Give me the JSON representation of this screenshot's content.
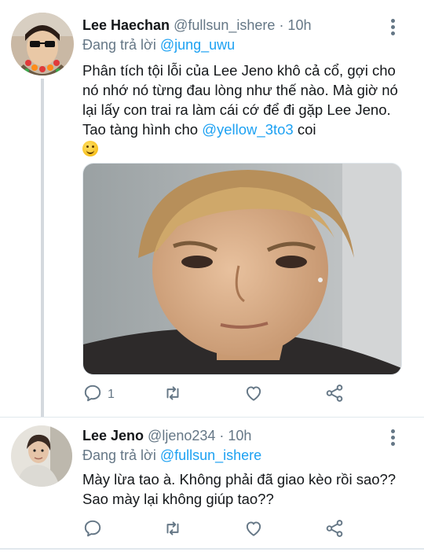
{
  "tweets": [
    {
      "name": "Lee Haechan",
      "handle": "@fullsun_ishere",
      "time": "· 10h",
      "reply_prefix": "Đang trả lời ",
      "reply_to": "@jung_uwu",
      "text_part1": "Phân tích tội lỗi của Lee Jeno khô cả cổ, gợi cho nó nhớ nó từng đau lòng như thế nào. Mà giờ nó lại lấy con trai ra làm cái cớ để đi gặp Lee Jeno. Tao tàng hình cho ",
      "text_mention": "@yellow_3to3",
      "text_part2": " coi",
      "emoji": "slightly-smiling-face",
      "has_media": true,
      "reply_count": "1"
    },
    {
      "name": "Lee Jeno",
      "handle": "@ljeno234",
      "time": "· 10h",
      "reply_prefix": "Đang trả lời ",
      "reply_to": "@fullsun_ishere",
      "text": "Mày lừa tao à. Không phải đã giao kèo rồi sao?? Sao mày lại không giúp tao??"
    }
  ],
  "icons": [
    "reply-icon",
    "retweet-icon",
    "like-icon",
    "share-icon",
    "more-icon"
  ],
  "colors": {
    "link": "#1da1f2",
    "muted": "#657786",
    "text": "#14171a"
  }
}
